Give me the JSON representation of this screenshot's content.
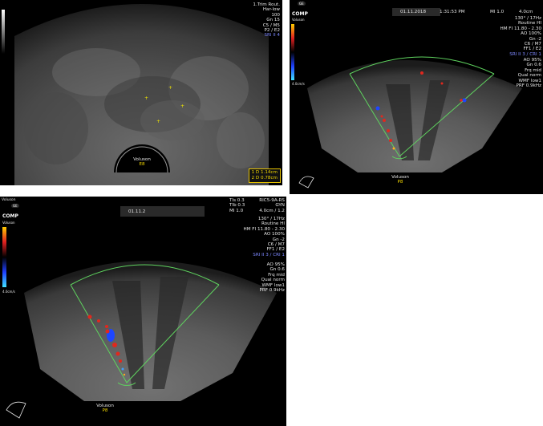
{
  "panel1": {
    "settings": [
      "1.Trim Rout.",
      "Har-low",
      "100",
      "Gn 15",
      "C5 / M5",
      "P2 / E2"
    ],
    "srimode": "SRI II 4",
    "probe": [
      "Voluson",
      "E8"
    ],
    "measurements": [
      "1  D 1.14cm",
      "2  D 0.78cm"
    ]
  },
  "panel2": {
    "header": {
      "date": "01.11.2018",
      "time": "1:31:53 PM",
      "mi": "MI  1.0",
      "depth": "4.0cm"
    },
    "comp_label": "COMP",
    "scale_top": "Voluson",
    "scale_bottom": "4.0cm/s",
    "settings": [
      "130° / 17Hz",
      "Routine HI",
      "HM FI 11.80 - 2.30",
      "AO 100%",
      "Gn -2",
      "C6 / M7",
      "FF1 / E2"
    ],
    "srimode": "SRI II 3 / CRI 1",
    "doppler": [
      "AO 95%",
      "Gn 0.6",
      "Frq mid",
      "Qual norm",
      "WMF low1",
      "PRF 0.9kHz"
    ],
    "probe": [
      "Voluson",
      "P8"
    ]
  },
  "panel3": {
    "header": {
      "tis": "TIs  0.3",
      "tib": "TIb  0.3",
      "mi": "MI  1.0",
      "date": "01.11.2",
      "probe_model": "RIC5-9A-RS",
      "preset": "GYN",
      "depth": "4.0cm / 1.2"
    },
    "brand": "Voluson",
    "comp_label": "COMP",
    "scale_top": "Voluson",
    "scale_bottom": "4.0cm/s",
    "settings": [
      "130° / 17Hz",
      "Routine HI",
      "HM FI 11.80 - 2.30",
      "AO 100%",
      "Gn -2",
      "C6 / M7",
      "FF1 / E2"
    ],
    "srimode": "SRI II 3 / CRI 1",
    "doppler": [
      "AO 95%",
      "Gn 0.6",
      "Frq mid",
      "Qual norm",
      "WMF low1",
      "PRF 0.9kHz"
    ],
    "probe": [
      "Voluson",
      "P8"
    ]
  },
  "colors": {
    "background": "#000000",
    "roi_box": "#5fd35f",
    "caliper": "#f2e600",
    "srimode": "#7d88ff",
    "doppler_red": "#e0281e",
    "doppler_blue": "#1e46ff"
  }
}
